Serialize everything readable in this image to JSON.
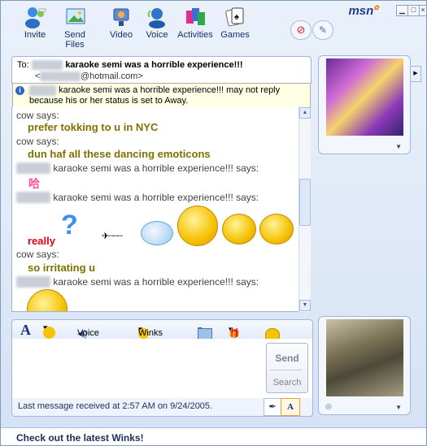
{
  "toolbar": {
    "items": [
      {
        "label": "Invite",
        "icon": "invite-icon"
      },
      {
        "label": "Send Files",
        "icon": "send-files-icon"
      },
      {
        "label": "Video",
        "icon": "video-icon"
      },
      {
        "label": "Voice",
        "icon": "voice-icon"
      },
      {
        "label": "Activities",
        "icon": "activities-icon"
      },
      {
        "label": "Games",
        "icon": "games-icon"
      }
    ],
    "logo": "msn"
  },
  "header": {
    "to_label": "To:",
    "contact_name": "karaoke semi was a horrible experience!!!",
    "contact_email_suffix": "@hotmail.com>",
    "email_prefix": "<"
  },
  "away_notice": {
    "line1": "karaoke semi was a horrible experience!!! may not reply",
    "line2": "because his or her status is set to Away."
  },
  "messages": [
    {
      "sender": "cow says:",
      "text": "prefer tokking to u in NYC"
    },
    {
      "sender": "cow says:",
      "text": "dun haf all these dancing emoticons"
    },
    {
      "sender": "karaoke semi was a horrible experience!!! says:",
      "text": ""
    },
    {
      "sender": "karaoke semi was a horrible experience!!! says:",
      "text": ""
    },
    {
      "sender": "",
      "text": "really"
    },
    {
      "sender": "cow says:",
      "text": "so irritating u"
    },
    {
      "sender": "karaoke semi was a horrible experience!!! says:",
      "text": ""
    }
  ],
  "compose": {
    "voice_clip": "Voice Clip",
    "winks": "Winks",
    "send": "Send",
    "search": "Search",
    "font_label": "A"
  },
  "status_text": "Last message received at 2:57 AM on 9/24/2005.",
  "bottom_bar": "Check out the latest Winks!"
}
